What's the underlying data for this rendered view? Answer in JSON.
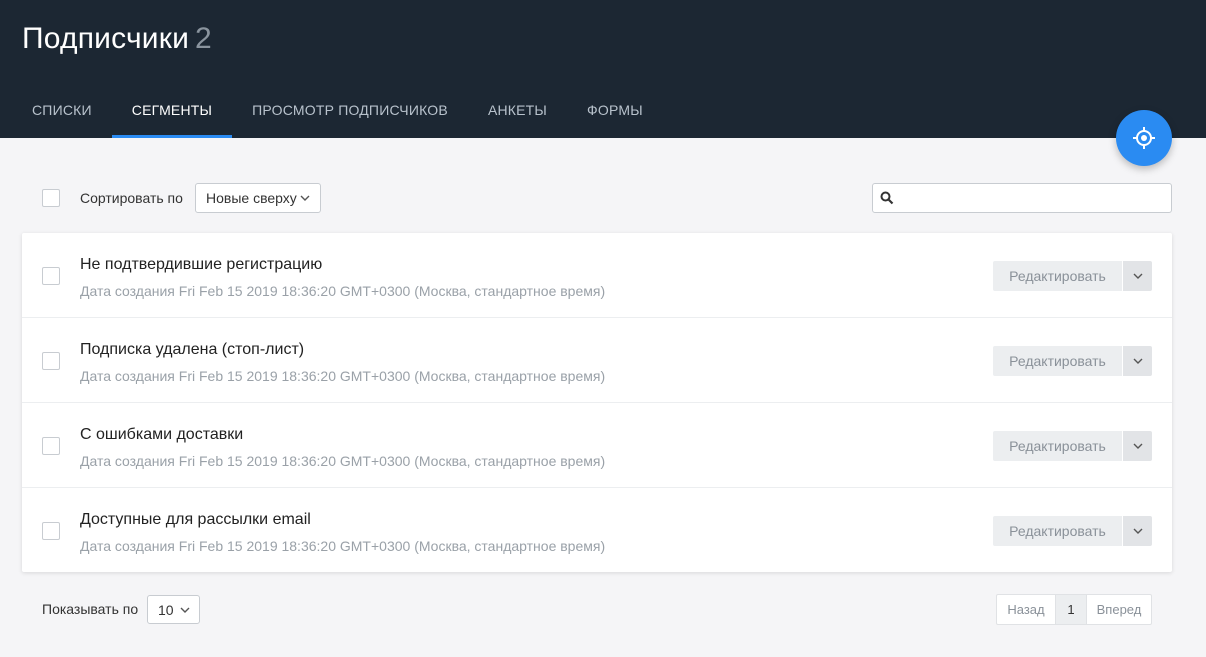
{
  "header": {
    "title": "Подписчики",
    "count": "2",
    "tabs": [
      {
        "label": "Списки",
        "active": false
      },
      {
        "label": "Сегменты",
        "active": true
      },
      {
        "label": "Просмотр подписчиков",
        "active": false
      },
      {
        "label": "Анкеты",
        "active": false
      },
      {
        "label": "Формы",
        "active": false
      }
    ]
  },
  "fab": {
    "icon": "target-icon",
    "color": "#2a8bf2"
  },
  "toolbar": {
    "sort_label": "Сортировать по",
    "sort_value": "Новые сверху",
    "search_placeholder": ""
  },
  "segments": [
    {
      "name": "Не подтвердившие регистрацию",
      "meta": "Дата создания Fri Feb 15 2019 18:36:20 GMT+0300 (Москва, стандартное время)",
      "edit_label": "Редактировать"
    },
    {
      "name": "Подписка удалена (стоп-лист)",
      "meta": "Дата создания Fri Feb 15 2019 18:36:20 GMT+0300 (Москва, стандартное время)",
      "edit_label": "Редактировать"
    },
    {
      "name": "С ошибками доставки",
      "meta": "Дата создания Fri Feb 15 2019 18:36:20 GMT+0300 (Москва, стандартное время)",
      "edit_label": "Редактировать"
    },
    {
      "name": "Доступные для рассылки email",
      "meta": "Дата создания Fri Feb 15 2019 18:36:20 GMT+0300 (Москва, стандартное время)",
      "edit_label": "Редактировать"
    }
  ],
  "footer": {
    "show_label": "Показывать по",
    "show_value": "10",
    "prev_label": "Назад",
    "current_page": "1",
    "next_label": "Вперед"
  },
  "colors": {
    "header_bg": "#1c2733",
    "accent": "#2a8bf2"
  }
}
